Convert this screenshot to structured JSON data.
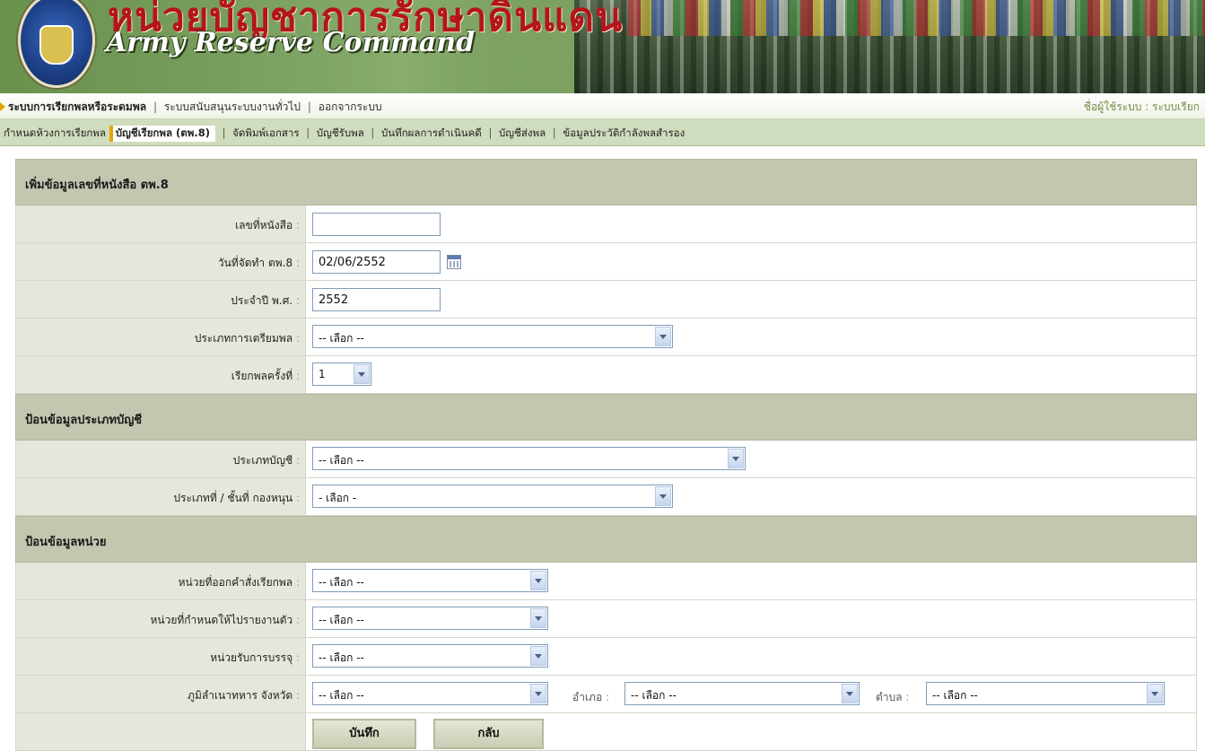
{
  "header": {
    "title_th": "หน่วยบัญชาการรักษาดินแดน",
    "title_en": "Army Reserve Command"
  },
  "nav_main": {
    "items": [
      "ระบบการเรียกพลหรือระดมพล",
      "ระบบสนับสนุนระบบงานทั่วไป",
      "ออกจากระบบ"
    ],
    "user_label": "ชื่อผู้ใช้ระบบ",
    "user_value": "ระบบเรียก"
  },
  "nav_sub": {
    "items": [
      "กำหนดห้วงการเรียกพล",
      "บัญชีเรียกพล (ตพ.8)",
      "จัดพิมพ์เอกสาร",
      "บัญชีรับพล",
      "บันทึกผลการดำเนินคดี",
      "บัญชีส่งพล",
      "ข้อมูลประวัติกำลังพลสำรอง"
    ]
  },
  "form": {
    "sections": [
      "เพิ่มข้อมูลเลขที่หนังสือ ตพ.8",
      "ป้อนข้อมูลประเภทบัญชี",
      "ป้อนข้อมูลหน่วย"
    ],
    "doc_no": {
      "label": "เลขที่หนังสือ",
      "value": ""
    },
    "date": {
      "label": "วันที่จัดทำ ตพ.8",
      "value": "02/06/2552"
    },
    "year": {
      "label": "ประจำปี พ.ศ.",
      "value": "2552"
    },
    "prep_type": {
      "label": "ประเภทการเตรียมพล",
      "value": "-- เลือก --"
    },
    "call_round": {
      "label": "เรียกพลครั้งที่",
      "value": "1"
    },
    "account_type": {
      "label": "ประเภทบัญชี",
      "value": "-- เลือก --"
    },
    "class": {
      "label": "ประเภทที่ / ชั้นที่ กองหนุน",
      "value": "- เลือก -"
    },
    "issuing_unit": {
      "label": "หน่วยที่ออกคำสั่งเรียกพล",
      "value": "-- เลือก --"
    },
    "report_unit": {
      "label": "หน่วยที่กำหนดให้ไปรายงานตัว",
      "value": "-- เลือก --"
    },
    "receiving_unit": {
      "label": "หน่วยรับการบรรจุ",
      "value": "-- เลือก --"
    },
    "domicile": {
      "label": "ภูมิลำเนาทหาร จังหวัด",
      "province": "-- เลือก --",
      "district_label": "อำเภอ",
      "district": "-- เลือก --",
      "subdistrict_label": "ตำบล",
      "subdistrict": "-- เลือก --"
    },
    "buttons": {
      "save": "บันทึก",
      "back": "กลับ"
    }
  }
}
